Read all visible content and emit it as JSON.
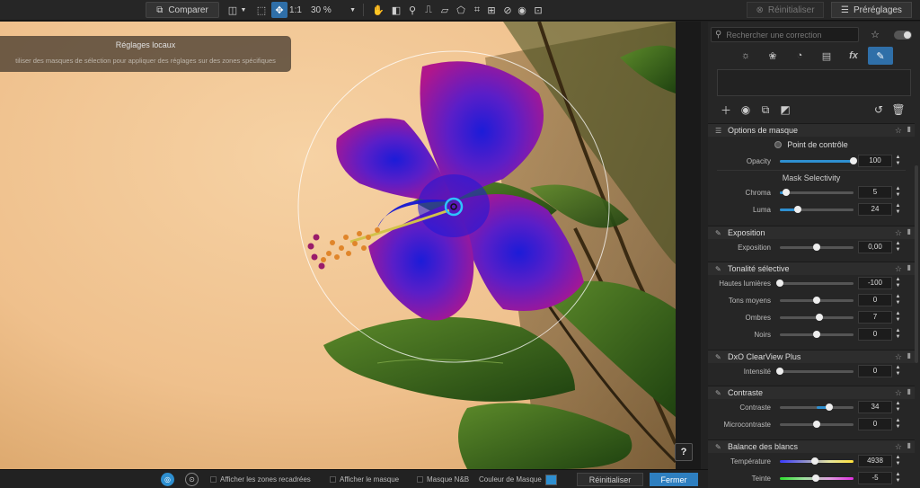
{
  "toolbar": {
    "compare_label": "Comparer",
    "ratio_label": "1:1",
    "zoom_value": "30 %",
    "reset_label": "Réinitialiser",
    "presets_label": "Préréglages"
  },
  "canvas": {
    "banner_title": "Réglages locaux",
    "banner_text": "tiliser des masques de sélection pour appliquer des réglages sur des zones spécifiques",
    "help_label": "?"
  },
  "bottom": {
    "show_crop_label": "Afficher les zones recadrées",
    "show_mask_label": "Afficher le masque",
    "mask_bw_label": "Masque N&B",
    "mask_color_label": "Couleur de Masque",
    "mask_color": "#2e8fd0",
    "reset_label": "Réinitialiser",
    "close_label": "Fermer"
  },
  "panel": {
    "search_placeholder": "Rechercher une correction",
    "tabs": [
      {
        "icon": "sun-icon",
        "glyph": "☼"
      },
      {
        "icon": "color-circles-icon",
        "glyph": "❀"
      },
      {
        "icon": "lens-icon",
        "glyph": "◔"
      },
      {
        "icon": "document-icon",
        "glyph": "▤"
      },
      {
        "icon": "fx-icon",
        "glyph": "fx"
      },
      {
        "icon": "brush-icon",
        "glyph": "✎"
      }
    ],
    "mask_options": {
      "title": "Options de masque",
      "control_point_label": "Point de contrôle",
      "opacity_label": "Opacity",
      "opacity_value": "100",
      "opacity_level": 1.0,
      "selectivity_title": "Mask Selectivity",
      "chroma_label": "Chroma",
      "chroma_value": "5",
      "chroma_level": 0.08,
      "luma_label": "Luma",
      "luma_value": "24",
      "luma_level": 0.24
    },
    "exposure": {
      "title": "Exposition",
      "label": "Exposition",
      "value": "0,00",
      "level": 0.5
    },
    "selective_tone": {
      "title": "Tonalité sélective",
      "rows": [
        {
          "label": "Hautes lumières",
          "value": "-100",
          "level": 0.0
        },
        {
          "label": "Tons moyens",
          "value": "0",
          "level": 0.5
        },
        {
          "label": "Ombres",
          "value": "7",
          "level": 0.535
        },
        {
          "label": "Noirs",
          "value": "0",
          "level": 0.5
        }
      ]
    },
    "clearview": {
      "title": "DxO ClearView Plus",
      "label": "Intensité",
      "value": "0",
      "level": 0.0
    },
    "contrast": {
      "title": "Contraste",
      "rows": [
        {
          "label": "Contraste",
          "value": "34",
          "level": 0.67
        },
        {
          "label": "Microcontraste",
          "value": "0",
          "level": 0.5
        }
      ]
    },
    "white_balance": {
      "title": "Balance des blancs",
      "rows": [
        {
          "label": "Température",
          "value": "4938",
          "level": 0.47
        },
        {
          "label": "Teinte",
          "value": "-5",
          "level": 0.49
        }
      ]
    }
  }
}
